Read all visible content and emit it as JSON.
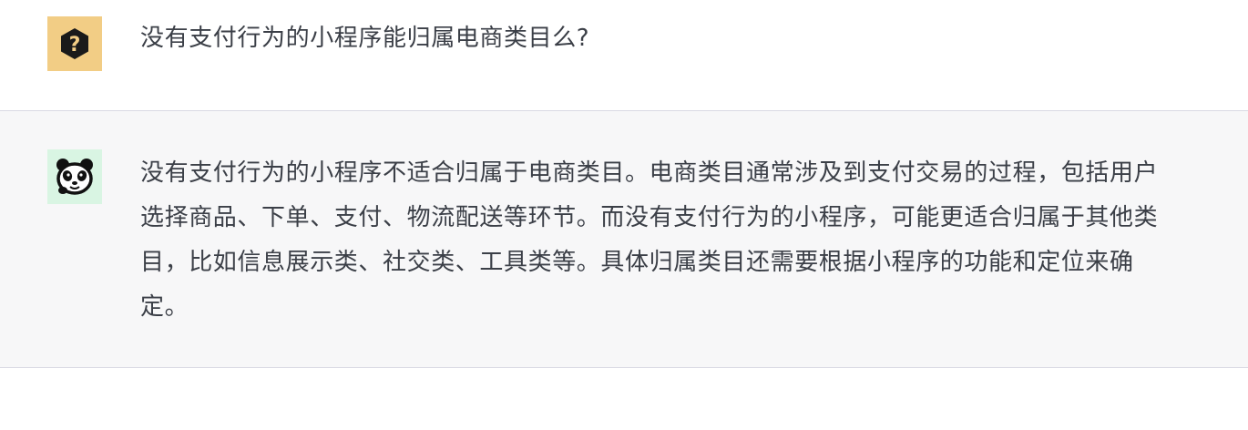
{
  "conversation": {
    "user_message": {
      "avatar_icon": "question-badge-icon",
      "avatar_color": "#f2cd85",
      "text": "没有支付行为的小程序能归属电商类目么?"
    },
    "assistant_message": {
      "avatar_icon": "panda-icon",
      "avatar_color": "#d9f5e3",
      "text": "没有支付行为的小程序不适合归属于电商类目。电商类目通常涉及到支付交易的过程，包括用户选择商品、下单、支付、物流配送等环节。而没有支付行为的小程序，可能更适合归属于其他类目，比如信息展示类、社交类、工具类等。具体归属类目还需要根据小程序的功能和定位来确定。"
    }
  }
}
